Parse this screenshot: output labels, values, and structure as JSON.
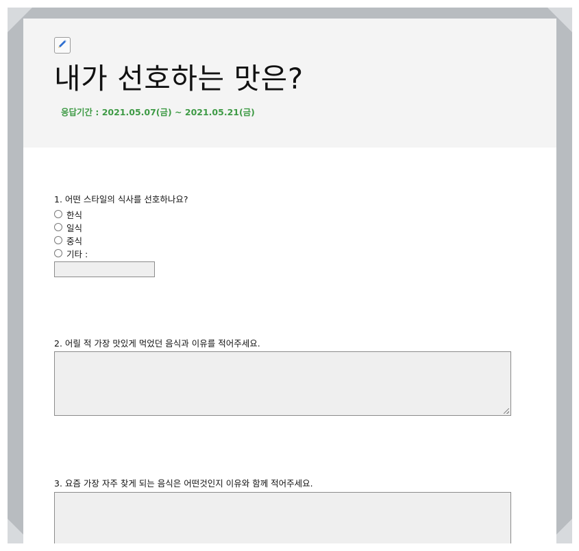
{
  "form": {
    "title": "내가 선호하는 맛은?",
    "period": "응답기간 : 2021.05.07(금) ~ 2021.05.21(금)",
    "edit_icon": "pencil-icon"
  },
  "questions": [
    {
      "label": "1. 어떤 스타일의 식사를 선호하나요?",
      "options": [
        "한식",
        "일식",
        "중식",
        "기타 :"
      ],
      "other_value": ""
    },
    {
      "label": "2. 어릴 적 가장 맛있게 먹었던 음식과 이유를 적어주세요.",
      "answer": ""
    },
    {
      "label": "3. 요즘 가장 자주 찾게 되는 음식은 어떤것인지 이유와 함께 적어주세요.",
      "answer": ""
    }
  ],
  "colors": {
    "frame": "#b8bcc0",
    "header_bg": "#f4f4f4",
    "period_text": "#3e9a45",
    "input_bg": "#efefef"
  }
}
